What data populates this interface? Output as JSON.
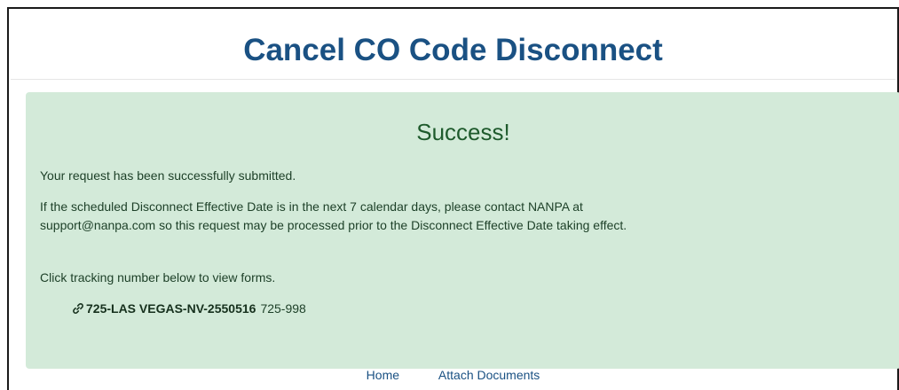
{
  "page": {
    "title": "Cancel CO Code Disconnect"
  },
  "alert": {
    "heading": "Success!",
    "message1": "Your request has been successfully submitted.",
    "message2": "If the scheduled Disconnect Effective Date is in the next 7 calendar days, please contact NANPA at support@nanpa.com so this request may be processed prior to the Disconnect Effective Date taking effect.",
    "message3": "Click tracking number below to view forms.",
    "tracking": {
      "id": "725-LAS VEGAS-NV-2550516",
      "range": "725-998",
      "icon": "link-icon"
    },
    "background_color": "#d3ead9",
    "text_color": "#1c3f27"
  },
  "footer": {
    "links": [
      "Home",
      "Attach Documents"
    ]
  },
  "colors": {
    "title": "#1a5183",
    "link": "#1a5183"
  }
}
